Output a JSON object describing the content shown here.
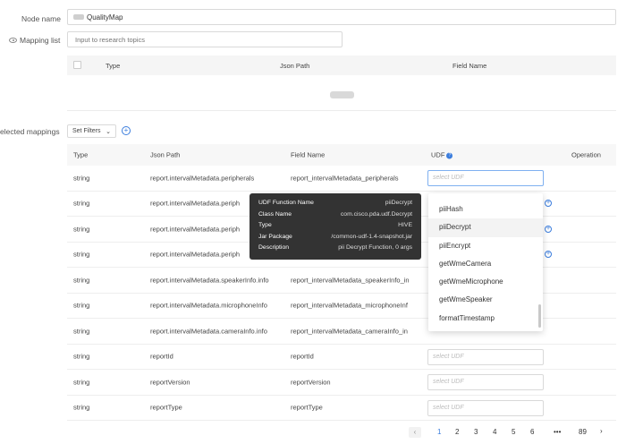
{
  "form": {
    "node_name_label": "Node name",
    "node_name_value": "QualityMap",
    "mapping_list_label": "Mapping list",
    "search_placeholder": "Input to research topics"
  },
  "upper_table": {
    "headers": [
      "Type",
      "Json Path",
      "Field Name"
    ]
  },
  "selected": {
    "label": "elected mappings",
    "filters_label": "Set Filters",
    "chevron": "⌄",
    "add": "+"
  },
  "grid": {
    "headers": {
      "type": "Type",
      "json": "Json Path",
      "field": "Field Name",
      "udf": "UDF",
      "op": "Operation"
    },
    "udf_placeholder": "select UDF",
    "rows": [
      {
        "type": "string",
        "json": "report.intervalMetadata.peripherals",
        "field": "report_intervalMetadata_peripherals",
        "udf": "select UDF"
      },
      {
        "type": "string",
        "json": "report.intervalMetadata.periph",
        "field": "",
        "udf": ""
      },
      {
        "type": "string",
        "json": "report.intervalMetadata.periph",
        "field": "",
        "udf": ""
      },
      {
        "type": "string",
        "json": "report.intervalMetadata.periph",
        "field": "",
        "udf": ""
      },
      {
        "type": "string",
        "json": "report.intervalMetadata.speakerInfo.info",
        "field": "report_intervalMetadata_speakerInfo_in",
        "udf": ""
      },
      {
        "type": "string",
        "json": "report.intervalMetadata.microphoneInfo",
        "field": "report_intervalMetadata_microphoneInf",
        "udf": ""
      },
      {
        "type": "string",
        "json": "report.intervalMetadata.cameraInfo.info",
        "field": "report_intervalMetadata_cameraInfo_in",
        "udf": ""
      },
      {
        "type": "string",
        "json": "reportId",
        "field": "reportId",
        "udf": "select UDF"
      },
      {
        "type": "string",
        "json": "reportVersion",
        "field": "reportVersion",
        "udf": "select UDF"
      },
      {
        "type": "string",
        "json": "reportType",
        "field": "reportType",
        "udf": "select UDF"
      }
    ]
  },
  "dropdown": {
    "items": [
      "piiHash",
      "piiDecrypt",
      "piiEncrypt",
      "getWmeCamera",
      "getWmeMicrophone",
      "getWmeSpeaker",
      "formatTimestamp"
    ],
    "active_index": 1
  },
  "tooltip": {
    "rows": [
      {
        "k": "UDF Function Name",
        "v": "piiDecrypt"
      },
      {
        "k": "Class Name",
        "v": "com.cisco.pda.udf.Decrypt"
      },
      {
        "k": "Type",
        "v": "HIVE"
      },
      {
        "k": "Jar Package",
        "v": "/common-udf-1.4-snapshot.jar"
      },
      {
        "k": "Description",
        "v": "pii Decrypt Function, 0 args"
      }
    ]
  },
  "pagination": {
    "prev": "‹",
    "pages": [
      "1",
      "2",
      "3",
      "4",
      "5",
      "6",
      "•••",
      "89"
    ],
    "next": "›",
    "current": "1"
  },
  "colors": {
    "accent": "#3b7ddd",
    "danger": "#e05050"
  },
  "icons": {
    "mapping_list": "eye-icon",
    "udf_help": "question-circle-icon",
    "ops": [
      "history-icon",
      "copy-icon",
      "delete-icon"
    ]
  }
}
